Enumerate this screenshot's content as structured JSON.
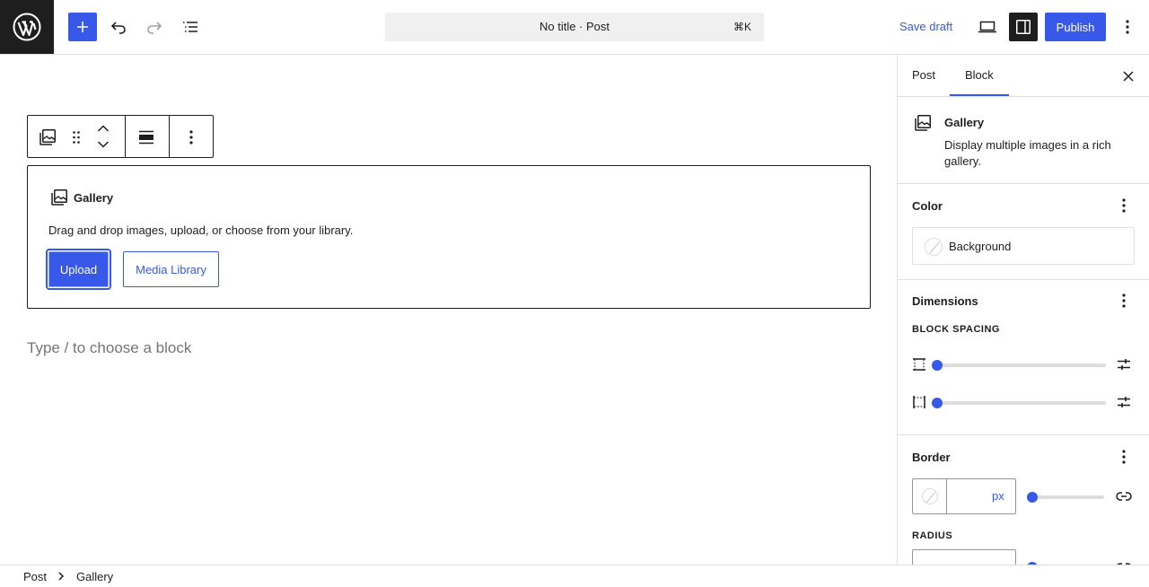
{
  "header": {
    "document_title": "No title · Post",
    "shortcut": "⌘K",
    "save_draft": "Save draft",
    "publish": "Publish",
    "icons": [
      "wordpress-icon",
      "plus-icon",
      "undo-icon",
      "redo-icon",
      "list-view-icon",
      "preview-icon",
      "sidebar-icon",
      "options-icon"
    ]
  },
  "block_toolbar": {
    "icons": [
      "gallery-icon",
      "drag-handle-icon",
      "move-up-icon",
      "move-down-icon",
      "align-icon",
      "more-options-icon"
    ]
  },
  "gallery_placeholder": {
    "label": "Gallery",
    "instructions": "Drag and drop images, upload, or choose from your library.",
    "upload": "Upload",
    "media_library": "Media Library"
  },
  "appender": {
    "placeholder": "Type / to choose a block"
  },
  "sidebar": {
    "tabs": [
      "Post",
      "Block"
    ],
    "active_tab": "Block",
    "block_card": {
      "name": "Gallery",
      "description": "Display multiple images in a rich gallery."
    },
    "color": {
      "title": "Color",
      "background_label": "Background"
    },
    "dimensions": {
      "title": "Dimensions",
      "block_spacing_label": "BLOCK SPACING",
      "vertical_spacing_value": 0,
      "horizontal_spacing_value": 0
    },
    "border": {
      "title": "Border",
      "width_unit": "px",
      "width_value": "",
      "radius_label": "RADIUS"
    }
  },
  "footer": {
    "breadcrumb": [
      "Post",
      "Gallery"
    ]
  },
  "colors": {
    "accent": "#3858e9",
    "dark": "#1e1e1e",
    "border": "#e0e0e0"
  }
}
